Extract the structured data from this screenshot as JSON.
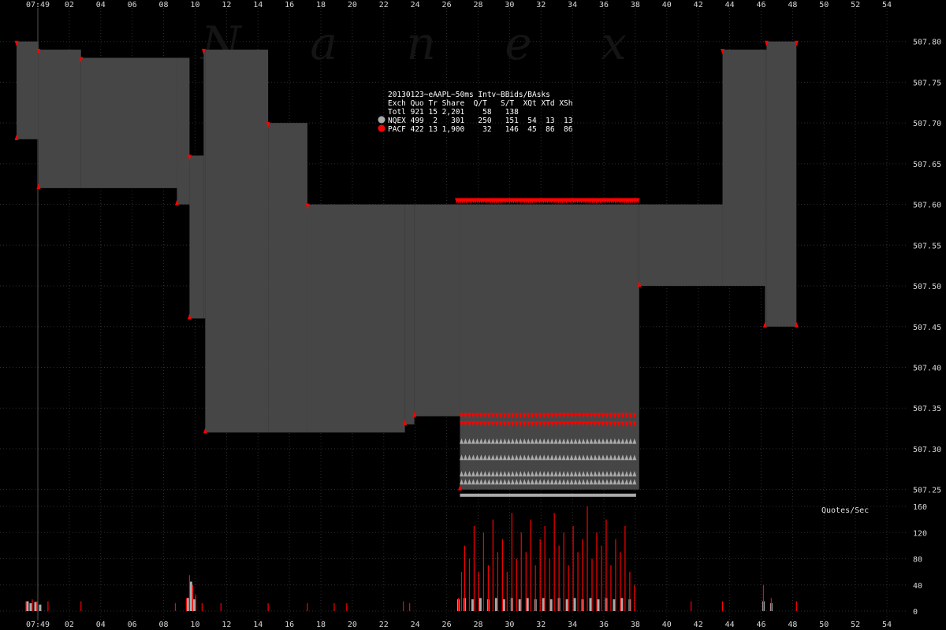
{
  "watermark": "N a n e x",
  "stats": {
    "title": "20130123~eAAPL~50ms Intv~BBids/BAsks",
    "header": "Exch Quo Tr Share  Q/T   S/T  XQt XTd XSh",
    "rows": [
      {
        "text": "Totl 921 15 2,201    58   138",
        "marker": "none"
      },
      {
        "text": "NQEX 499  2   301   250   151  54  13  13",
        "marker": "#aaaaaa"
      },
      {
        "text": "PACF 422 13 1,900    32   146  45  86  86",
        "marker": "#ff0000"
      }
    ]
  },
  "quotes_label": "Quotes/Sec",
  "colors": {
    "background": "#000000",
    "spread": "#464646",
    "grid": "#2e2e2e",
    "nqex": "#aaaaaa",
    "pacf": "#ff0000",
    "text": "#d8d8d8"
  },
  "chart_data": {
    "type": "area",
    "description_axis": "x = time within the 07:49 minute, in seconds",
    "x_tick_labels": [
      "07:49",
      "02",
      "04",
      "06",
      "08",
      "10",
      "12",
      "14",
      "16",
      "18",
      "20",
      "22",
      "24",
      "26",
      "28",
      "30",
      "32",
      "34",
      "36",
      "38",
      "40",
      "42",
      "44",
      "46",
      "48",
      "50",
      "52",
      "54"
    ],
    "xlim": [
      0,
      55
    ],
    "price_axis": {
      "ticks": [
        "507.25",
        "507.30",
        "507.35",
        "507.40",
        "507.45",
        "507.50",
        "507.55",
        "507.60",
        "507.65",
        "507.70",
        "507.75",
        "507.80"
      ],
      "ylim": [
        507.24,
        507.82
      ]
    },
    "series": [
      {
        "name": "Best Ask",
        "steps": [
          [
            0,
            507.8
          ],
          [
            1.4,
            507.79
          ],
          [
            4.1,
            507.78
          ],
          [
            11.0,
            507.66
          ],
          [
            11.9,
            507.79
          ],
          [
            16.0,
            507.7
          ],
          [
            18.5,
            507.6
          ],
          [
            44.9,
            507.79
          ],
          [
            47.7,
            507.8
          ],
          [
            49.6,
            507.8
          ]
        ]
      },
      {
        "name": "Best Bid",
        "steps": [
          [
            0,
            507.68
          ],
          [
            1.4,
            507.62
          ],
          [
            10.2,
            507.6
          ],
          [
            11.0,
            507.46
          ],
          [
            12.0,
            507.32
          ],
          [
            24.7,
            507.33
          ],
          [
            25.3,
            507.34
          ],
          [
            28.2,
            507.25
          ],
          [
            39.6,
            507.5
          ],
          [
            47.6,
            507.45
          ],
          [
            49.6,
            507.45
          ]
        ]
      }
    ],
    "quote_rate_axis": {
      "ticks": [
        "0",
        "40",
        "80",
        "120",
        "160"
      ],
      "ylim": [
        0,
        160
      ]
    },
    "quote_rate_series": [
      {
        "name": "NQEX",
        "points": [
          [
            0.7,
            15
          ],
          [
            0.9,
            12
          ],
          [
            1.2,
            14
          ],
          [
            1.5,
            10
          ],
          [
            10.9,
            20
          ],
          [
            11.1,
            45
          ],
          [
            11.3,
            18
          ],
          [
            28.1,
            18
          ],
          [
            28.5,
            20
          ],
          [
            29.0,
            18
          ],
          [
            29.5,
            20
          ],
          [
            30.0,
            18
          ],
          [
            30.5,
            20
          ],
          [
            31.0,
            18
          ],
          [
            31.5,
            20
          ],
          [
            32.0,
            18
          ],
          [
            32.5,
            20
          ],
          [
            33.0,
            18
          ],
          [
            33.5,
            20
          ],
          [
            34.0,
            18
          ],
          [
            34.5,
            20
          ],
          [
            35.0,
            18
          ],
          [
            35.5,
            20
          ],
          [
            36.0,
            18
          ],
          [
            36.5,
            20
          ],
          [
            37.0,
            18
          ],
          [
            37.5,
            20
          ],
          [
            38.0,
            18
          ],
          [
            38.5,
            20
          ],
          [
            39.0,
            18
          ],
          [
            47.5,
            15
          ],
          [
            48.0,
            12
          ]
        ]
      },
      {
        "name": "PACF",
        "points": [
          [
            0.6,
            15
          ],
          [
            1.0,
            18
          ],
          [
            1.3,
            15
          ],
          [
            2.0,
            15
          ],
          [
            4.1,
            15
          ],
          [
            10.1,
            12
          ],
          [
            10.8,
            20
          ],
          [
            11.0,
            55
          ],
          [
            11.2,
            40
          ],
          [
            11.4,
            25
          ],
          [
            11.8,
            12
          ],
          [
            13.0,
            12
          ],
          [
            16.0,
            12
          ],
          [
            18.5,
            12
          ],
          [
            20.2,
            12
          ],
          [
            21.0,
            12
          ],
          [
            24.6,
            15
          ],
          [
            25.0,
            12
          ],
          [
            28.1,
            20
          ],
          [
            28.3,
            60
          ],
          [
            28.5,
            100
          ],
          [
            28.8,
            80
          ],
          [
            29.1,
            130
          ],
          [
            29.4,
            60
          ],
          [
            29.7,
            120
          ],
          [
            30.0,
            70
          ],
          [
            30.3,
            140
          ],
          [
            30.6,
            90
          ],
          [
            30.9,
            110
          ],
          [
            31.2,
            60
          ],
          [
            31.5,
            150
          ],
          [
            31.8,
            80
          ],
          [
            32.1,
            120
          ],
          [
            32.4,
            90
          ],
          [
            32.7,
            140
          ],
          [
            33.0,
            70
          ],
          [
            33.3,
            110
          ],
          [
            33.6,
            130
          ],
          [
            33.9,
            80
          ],
          [
            34.2,
            150
          ],
          [
            34.5,
            100
          ],
          [
            34.8,
            120
          ],
          [
            35.1,
            70
          ],
          [
            35.4,
            130
          ],
          [
            35.7,
            90
          ],
          [
            36.0,
            110
          ],
          [
            36.3,
            160
          ],
          [
            36.6,
            80
          ],
          [
            36.9,
            120
          ],
          [
            37.2,
            100
          ],
          [
            37.5,
            140
          ],
          [
            37.8,
            70
          ],
          [
            38.1,
            110
          ],
          [
            38.4,
            90
          ],
          [
            38.7,
            130
          ],
          [
            39.0,
            60
          ],
          [
            39.3,
            40
          ],
          [
            42.9,
            15
          ],
          [
            44.9,
            15
          ],
          [
            47.5,
            40
          ],
          [
            48.0,
            20
          ],
          [
            49.6,
            15
          ]
        ]
      }
    ]
  }
}
